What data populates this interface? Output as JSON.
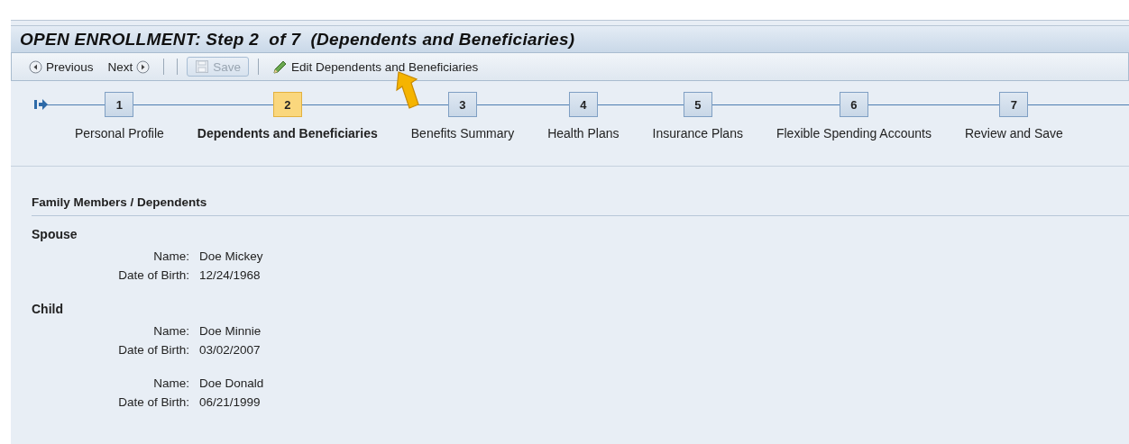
{
  "window": {
    "title": "OPEN ENROLLMENT: Step 2  of 7  (Dependents and Beneficiaries)"
  },
  "toolbar": [
    {
      "kind": "previous",
      "label": "Previous",
      "disabled": false
    },
    {
      "kind": "next",
      "label": "Next",
      "disabled": false
    },
    {
      "kind": "save",
      "label": "Save",
      "disabled": true
    },
    {
      "kind": "edit",
      "label": "Edit Dependents and Beneficiaries",
      "disabled": false
    }
  ],
  "steps": [
    {
      "number": "1",
      "label": "Personal Profile",
      "selected": false
    },
    {
      "number": "2",
      "label": "Dependents and Beneficiaries",
      "selected": true
    },
    {
      "number": "3",
      "label": "Benefits Summary",
      "selected": false
    },
    {
      "number": "4",
      "label": "Health Plans",
      "selected": false
    },
    {
      "number": "5",
      "label": "Insurance Plans",
      "selected": false
    },
    {
      "number": "6",
      "label": "Flexible Spending Accounts",
      "selected": false
    },
    {
      "number": "7",
      "label": "Review and Save",
      "selected": false
    }
  ],
  "section": {
    "title": "Family Members / Dependents",
    "groups": [
      {
        "title": "Spouse",
        "members": [
          {
            "fields": [
              {
                "label": "Name:",
                "value": "Doe Mickey"
              },
              {
                "label": "Date of Birth:",
                "value": "12/24/1968"
              }
            ]
          }
        ]
      },
      {
        "title": "Child",
        "members": [
          {
            "fields": [
              {
                "label": "Name:",
                "value": "Doe Minnie"
              },
              {
                "label": "Date of Birth:",
                "value": "03/02/2007"
              }
            ]
          },
          {
            "fields": [
              {
                "label": "Name:",
                "value": "Doe Donald"
              },
              {
                "label": "Date of Birth:",
                "value": "06/21/1999"
              }
            ]
          }
        ]
      }
    ]
  }
}
